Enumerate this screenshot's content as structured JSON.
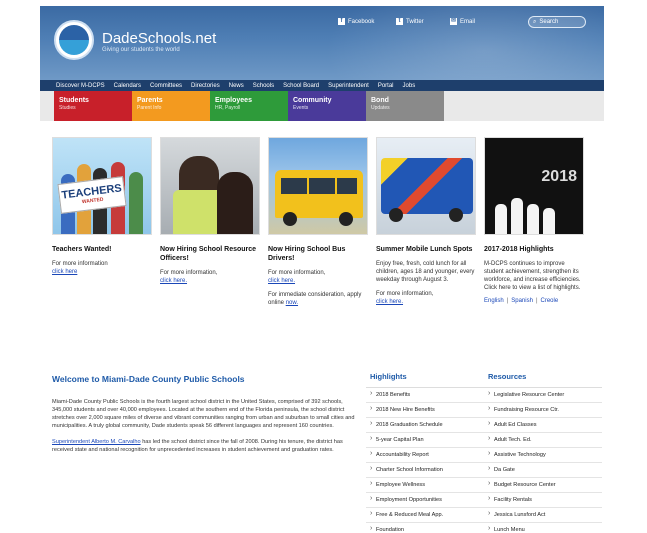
{
  "header": {
    "brand_name": "DadeSchools.net",
    "brand_tagline": "Giving our students the world",
    "social": {
      "facebook": "Facebook",
      "twitter": "Twitter",
      "email": "Email"
    },
    "search_placeholder": "Search"
  },
  "nav": {
    "items": [
      "Discover M-DCPS",
      "Calendars",
      "Committees",
      "Directories",
      "News",
      "Schools",
      "School Board",
      "Superintendent",
      "Portal",
      "Jobs"
    ]
  },
  "audience_tabs": [
    {
      "title": "Students",
      "sub": "Studies",
      "color": "#c8202a"
    },
    {
      "title": "Parents",
      "sub": "Parent Info",
      "color": "#f39a1f"
    },
    {
      "title": "Employees",
      "sub": "HR, Payroll",
      "color": "#2e9b3a"
    },
    {
      "title": "Community",
      "sub": "Events",
      "color": "#4a3a9a"
    },
    {
      "title": "Bond",
      "sub": "Updates",
      "color": "#8a8a8a"
    }
  ],
  "cards": [
    {
      "title": "Teachers Wanted!",
      "body": "For more information",
      "link": "click here",
      "sign_text": "TEACHERS",
      "sign_sub": "WANTED"
    },
    {
      "title": "Now Hiring School Resource Officers!",
      "body": "For more information,",
      "link": "click here."
    },
    {
      "title": "Now Hiring School Bus Drivers!",
      "body": "For more information,",
      "link": "click here.",
      "body2": "For immediate consideration, apply online",
      "link2": "now."
    },
    {
      "title": "Summer Mobile Lunch Spots",
      "body": "Enjoy free, fresh, cold lunch for all children, ages 18 and younger, every weekday through August 3.",
      "body2": "For more information,",
      "link": "click here."
    },
    {
      "title": "2017-2018 Highlights",
      "body": "M-DCPS continues to improve student achievement, strengthen its workforce, and increase efficiencies. Click here to view a list of highlights.",
      "year": "2018",
      "languages": [
        "English",
        "Spanish",
        "Creole"
      ]
    }
  ],
  "welcome": {
    "heading": "Welcome to Miami-Dade County Public Schools",
    "p1": "Miami-Dade County Public Schools is the fourth largest school district in the United States, comprised of 392 schools, 345,000 students and over 40,000 employees. Located at the southern end of the Florida peninsula, the school district stretches over 2,000 square miles of diverse and vibrant communities ranging from urban and suburban to small cities and municipalities. A truly global community, Dade students speak 56 different languages and represent 160 countries.",
    "p2_link": "Superintendent Alberto M. Carvalho",
    "p2": "has led the school district since the fall of 2008. During his tenure, the district has received state and national recognition for unprecedented increases in student achievement and graduation rates."
  },
  "highlights": {
    "heading": "Highlights",
    "items": [
      "2018 Benefits",
      "2018 New Hire Benefits",
      "2018 Graduation Schedule",
      "5-year Capital Plan",
      "Accountability Report",
      "Charter School Information",
      "Employee Wellness",
      "Employment Opportunities",
      "Free & Reduced Meal App.",
      "Foundation"
    ]
  },
  "resources": {
    "heading": "Resources",
    "items": [
      "Legislative Resource Center",
      "Fundraising Resource Ctr.",
      "Adult Ed Classes",
      "Adult Tech. Ed.",
      "Assistive Technology",
      "Da Gate",
      "Budget Resource Center",
      "Facility Rentals",
      "Jessica Lunsford Act",
      "Lunch Menu"
    ]
  }
}
